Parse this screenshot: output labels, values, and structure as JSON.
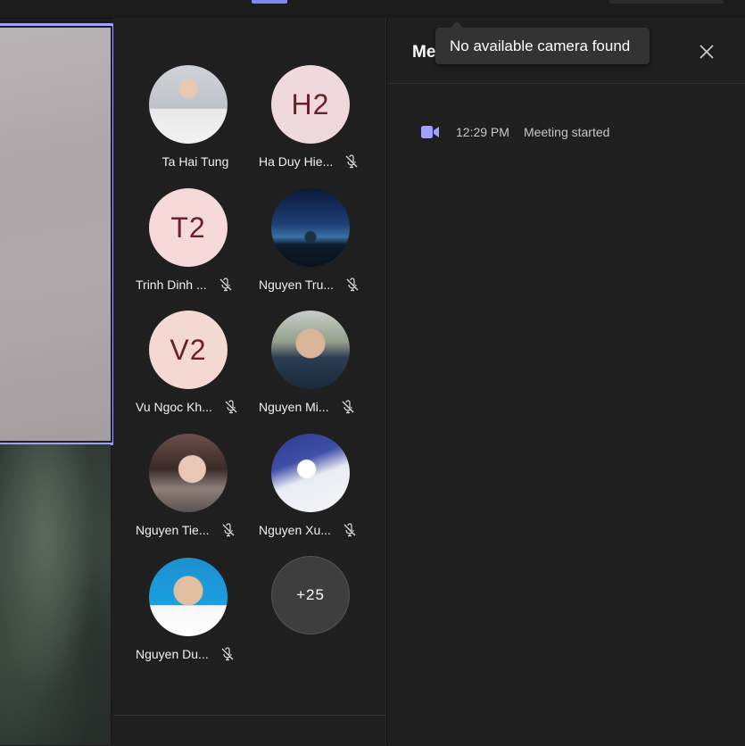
{
  "tooltip": {
    "text": "No available camera found"
  },
  "panel": {
    "title": "Me",
    "close_icon": "close-icon",
    "events": [
      {
        "icon": "video-camera-icon",
        "time": "12:29 PM",
        "text": "Meeting started"
      }
    ]
  },
  "participants": [
    {
      "name": "Ta Hai Tung",
      "avatar": "photo",
      "muted": false
    },
    {
      "name": "Ha Duy Hie...",
      "avatar": "initials",
      "initials": "H2",
      "bg": "#f0d9dc",
      "muted": true
    },
    {
      "name": "Trinh Dinh ...",
      "avatar": "initials",
      "initials": "T2",
      "bg": "#f6dada",
      "muted": true
    },
    {
      "name": "Nguyen Tru...",
      "avatar": "photo",
      "muted": true
    },
    {
      "name": "Vu Ngoc Kh...",
      "avatar": "initials",
      "initials": "V2",
      "bg": "#f4d9d2",
      "muted": true
    },
    {
      "name": "Nguyen Mi...",
      "avatar": "photo",
      "muted": true
    },
    {
      "name": "Nguyen Tie...",
      "avatar": "photo",
      "muted": true
    },
    {
      "name": "Nguyen Xu...",
      "avatar": "photo",
      "muted": true
    },
    {
      "name": "Nguyen Du...",
      "avatar": "photo",
      "muted": true
    }
  ],
  "overflow": {
    "label": "+25"
  },
  "colors": {
    "accent": "#9ea2ff",
    "icon_purple": "#9ea2ff",
    "mic_off": "#e0e0e0"
  }
}
